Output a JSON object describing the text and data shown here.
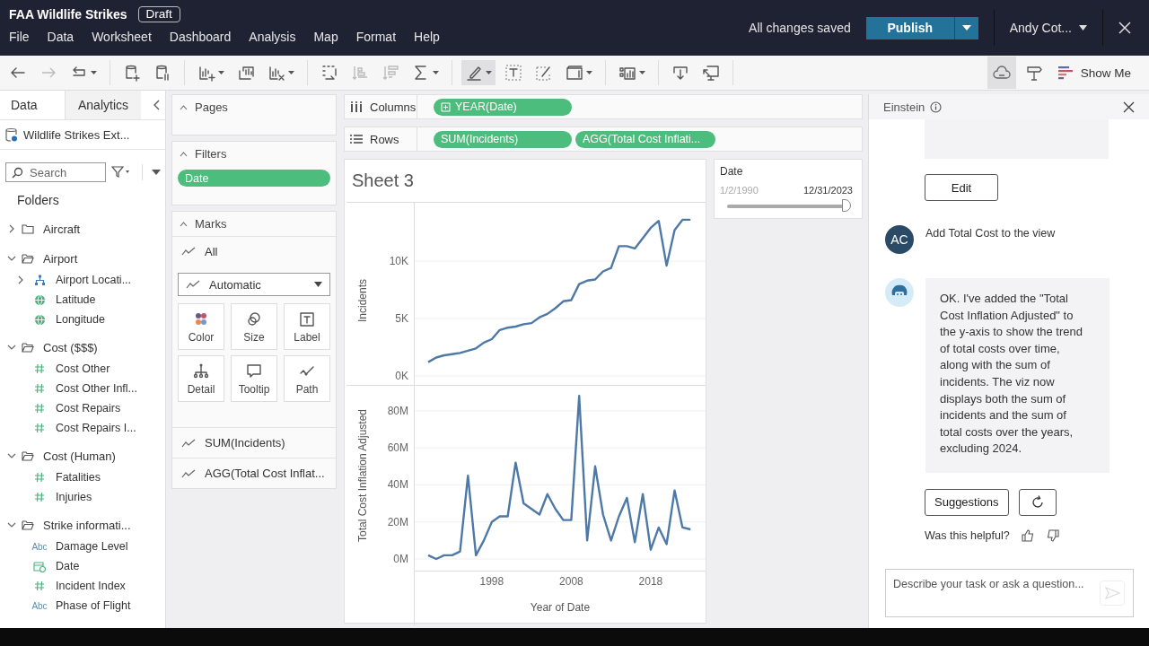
{
  "workbook": {
    "title": "FAA Wildlife Strikes",
    "badge": "Draft"
  },
  "menu": [
    "File",
    "Data",
    "Worksheet",
    "Dashboard",
    "Analysis",
    "Map",
    "Format",
    "Help"
  ],
  "save_status": "All changes saved",
  "publish_button": "Publish",
  "user": "Andy Cot...",
  "toolbar": {
    "highlight_selected": true,
    "einstein_selected": true,
    "show_me": "Show Me"
  },
  "data_pane": {
    "tabs": [
      {
        "label": "Data",
        "selected": true
      },
      {
        "label": "Analytics",
        "selected": false
      }
    ],
    "datasource": "Wildlife Strikes Ext...",
    "search": {
      "placeholder": "Search"
    },
    "folders_label": "Folders",
    "tree": [
      {
        "label": "Aircraft",
        "kind": "folder",
        "expanded": false
      },
      {
        "label": "Airport",
        "kind": "folder",
        "expanded": true,
        "children": [
          {
            "label": "Airport Locati...",
            "kind": "hierarchy",
            "expanded": false
          },
          {
            "label": "Latitude",
            "kind": "geo"
          },
          {
            "label": "Longitude",
            "kind": "geo"
          }
        ]
      },
      {
        "label": "Cost ($$$)",
        "kind": "folder",
        "expanded": true,
        "children": [
          {
            "label": "Cost Other",
            "kind": "measure"
          },
          {
            "label": "Cost Other Infl...",
            "kind": "measure"
          },
          {
            "label": "Cost Repairs",
            "kind": "measure"
          },
          {
            "label": "Cost Repairs I...",
            "kind": "measure"
          }
        ]
      },
      {
        "label": "Cost (Human)",
        "kind": "folder",
        "expanded": true,
        "children": [
          {
            "label": "Fatalities",
            "kind": "measure"
          },
          {
            "label": "Injuries",
            "kind": "measure"
          }
        ]
      },
      {
        "label": "Strike informati...",
        "kind": "folder",
        "expanded": true,
        "children": [
          {
            "label": "Damage Level",
            "kind": "string",
            "icon_text": "Abc"
          },
          {
            "label": "Date",
            "kind": "date"
          },
          {
            "label": "Incident Index",
            "kind": "measure"
          },
          {
            "label": "Phase of Flight",
            "kind": "string",
            "icon_text": "Abc"
          }
        ]
      }
    ]
  },
  "pages": {
    "title": "Pages"
  },
  "filters": {
    "title": "Filters",
    "pills": [
      "Date"
    ]
  },
  "marks": {
    "title": "Marks",
    "all": "All",
    "mark_type": "Automatic",
    "cards": [
      {
        "label": "Color",
        "kind": "color"
      },
      {
        "label": "Size",
        "kind": "size"
      },
      {
        "label": "Label",
        "kind": "label"
      },
      {
        "label": "Detail",
        "kind": "detail"
      },
      {
        "label": "Tooltip",
        "kind": "tooltip"
      },
      {
        "label": "Path",
        "kind": "path"
      }
    ],
    "measures": [
      "SUM(Incidents)",
      "AGG(Total Cost Inflat..."
    ]
  },
  "shelves": [
    {
      "label": "Columns",
      "kind": "columns",
      "pills": [
        "YEAR(Date)"
      ]
    },
    {
      "label": "Rows",
      "kind": "rows",
      "pills": [
        "SUM(Incidents)",
        "AGG(Total Cost Inflati..."
      ]
    }
  ],
  "sheet": {
    "title": "Sheet 3",
    "panes": [
      {
        "chart_data": {
          "type": "line",
          "ylabel": "Incidents",
          "x": [
            1990,
            1991,
            1992,
            1993,
            1994,
            1995,
            1996,
            1997,
            1998,
            1999,
            2000,
            2001,
            2002,
            2003,
            2004,
            2005,
            2006,
            2007,
            2008,
            2009,
            2010,
            2011,
            2012,
            2013,
            2014,
            2015,
            2016,
            2017,
            2018,
            2019,
            2020,
            2021,
            2022,
            2023
          ],
          "xlim": [
            1988.3,
            2024.9
          ],
          "ylim": [
            0,
            15000
          ],
          "grid": true,
          "yticks": [
            {
              "value": 0,
              "label": "0K"
            },
            {
              "value": 5000,
              "label": "5K"
            },
            {
              "value": 10000,
              "label": "10K"
            }
          ],
          "series": [
            {
              "color": "#4e79a7",
              "values": [
                1200,
                1600,
                1800,
                1900,
                2000,
                2200,
                2400,
                2900,
                3200,
                4000,
                4200,
                4300,
                4500,
                4600,
                5100,
                5400,
                5900,
                6500,
                6600,
                8000,
                8300,
                8400,
                9100,
                9400,
                11300,
                11300,
                11100,
                12000,
                12900,
                13500,
                9600,
                12700,
                13600,
                13600
              ]
            }
          ]
        }
      },
      {
        "chart_data": {
          "type": "line",
          "ylabel": "Total Cost Inflation Adjusted",
          "xlabel": "Year of Date",
          "x": [
            1990,
            1991,
            1992,
            1993,
            1994,
            1995,
            1996,
            1997,
            1998,
            1999,
            2000,
            2001,
            2002,
            2003,
            2004,
            2005,
            2006,
            2007,
            2008,
            2009,
            2010,
            2011,
            2012,
            2013,
            2014,
            2015,
            2016,
            2017,
            2018,
            2019,
            2020,
            2021,
            2022,
            2023
          ],
          "xlim": [
            1988.3,
            2024.9
          ],
          "ylim": [
            0,
            93000000
          ],
          "grid": true,
          "xticks": [
            1998,
            2008,
            2018
          ],
          "yticks": [
            {
              "value": 0,
              "label": "0M"
            },
            {
              "value": 20000000,
              "label": "20M"
            },
            {
              "value": 40000000,
              "label": "40M"
            },
            {
              "value": 60000000,
              "label": "60M"
            },
            {
              "value": 80000000,
              "label": "80M"
            }
          ],
          "series": [
            {
              "color": "#4e79a7",
              "values": [
                2000000,
                0,
                2000000,
                2000000,
                4000000,
                45000000,
                2000000,
                10000000,
                20000000,
                23000000,
                23000000,
                52000000,
                30000000,
                27000000,
                24000000,
                35000000,
                27000000,
                21000000,
                21000000,
                88000000,
                10000000,
                50000000,
                24000000,
                10000000,
                23000000,
                33000000,
                9000000,
                35000000,
                5000000,
                17000000,
                8000000,
                37000000,
                17000000,
                16000000
              ]
            }
          ]
        }
      }
    ]
  },
  "date_filter": {
    "title": "Date",
    "start": "1/2/1990",
    "end": "12/31/2023",
    "level": 1
  },
  "einstein": {
    "title": "Einstein",
    "edit_button": "Edit",
    "messages": [
      {
        "kind": "user",
        "avatar": "AC",
        "text": "Add Total Cost to the view"
      },
      {
        "kind": "assistant",
        "text": "OK. I've added the \"Total Cost Inflation Adjusted\" to the y-axis to show the trend of total costs over time, along with the sum of incidents. The viz now displays both the sum of incidents and the sum of total costs over the years, excluding 2024."
      }
    ],
    "suggestions_button": "Suggestions",
    "feedback_prompt": "Was this helpful?",
    "input": {
      "placeholder": "Describe your task or ask a question..."
    }
  }
}
